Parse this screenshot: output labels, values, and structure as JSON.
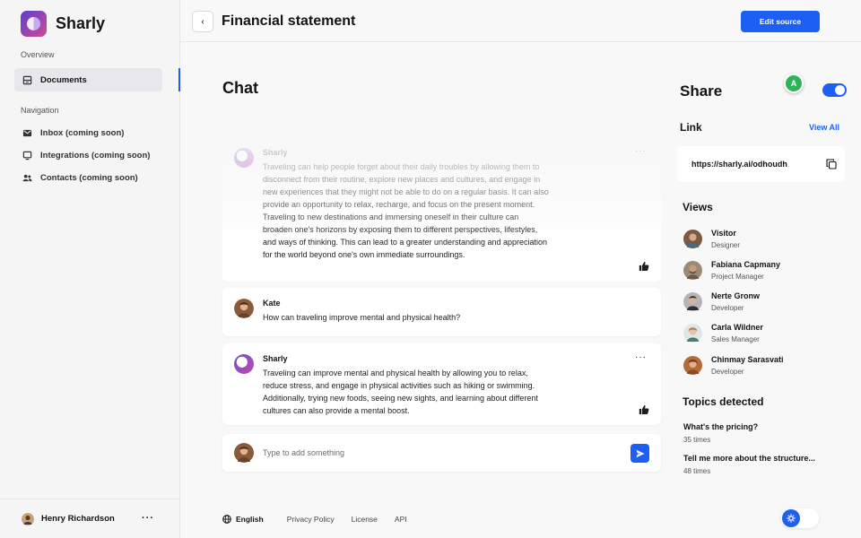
{
  "app": {
    "name": "Sharly"
  },
  "sidebar": {
    "overview_label": "Overview",
    "documents_label": "Documents",
    "navigation_label": "Navigation",
    "nav_items": [
      {
        "label": "Inbox (coming soon)",
        "icon": "mail-icon"
      },
      {
        "label": "Integrations (coming soon)",
        "icon": "monitor-icon"
      },
      {
        "label": "Contacts (coming soon)",
        "icon": "people-icon"
      }
    ],
    "user": {
      "name": "Henry Richardson",
      "more": "···"
    }
  },
  "header": {
    "title": "Financial statement",
    "back": "‹",
    "edit_source_label": "Edit source"
  },
  "chat": {
    "title": "Chat",
    "messages": [
      {
        "author": "Sharly",
        "text": "Traveling can help people forget about their daily troubles by allowing them to disconnect from their routine, explore new places and cultures, and engage in new experiences that they might not be able to do on a regular basis. It can also provide an opportunity to relax, recharge, and focus on the present moment. Traveling to new destinations and immersing oneself in their culture can broaden one's horizons by exposing them to different perspectives, lifestyles, and ways of thinking. This can lead to a greater understanding and appreciation for the world beyond one's own immediate surroundings.",
        "more": "···"
      },
      {
        "author": "Kate",
        "text": "How can traveling improve mental and physical health?"
      },
      {
        "author": "Sharly",
        "text": "Traveling can improve mental and physical health by allowing you to relax, reduce stress, and engage in physical activities such as hiking or swimming. Additionally, trying new foods, seeing new sights, and learning about different cultures can also provide a mental boost.",
        "more": "···"
      }
    ],
    "composer_placeholder": "Type to add something"
  },
  "footer": {
    "language": "English",
    "links": [
      "Privacy Policy",
      "License",
      "API"
    ]
  },
  "share": {
    "title": "Share",
    "presence_initial": "A",
    "toggle_on": true,
    "link_heading": "Link",
    "view_all": "View All",
    "link_url": "https://sharly.ai/odhoudh",
    "views_heading": "Views",
    "viewers": [
      {
        "name": "Visitor",
        "role": "Designer"
      },
      {
        "name": "Fabiana Capmany",
        "role": "Project Manager"
      },
      {
        "name": "Nerte Gronw",
        "role": "Developer"
      },
      {
        "name": "Carla Wildner",
        "role": "Sales Manager"
      },
      {
        "name": "Chinmay Sarasvati",
        "role": "Developer"
      }
    ],
    "topics_heading": "Topics detected",
    "topics": [
      {
        "question": "What's the pricing?",
        "count": "35 times"
      },
      {
        "question": "Tell me more about the structure...",
        "count": "48 times"
      }
    ]
  },
  "colors": {
    "accent": "#1d5ff5",
    "presence": "#2fb35a"
  }
}
